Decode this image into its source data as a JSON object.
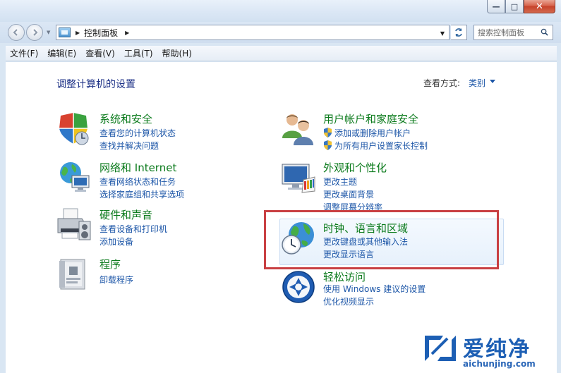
{
  "window": {
    "minimize_glyph": "—",
    "maximize_glyph": "□",
    "close_glyph": "✕"
  },
  "navigation": {
    "breadcrumb": "控制面板",
    "search_placeholder": "搜索控制面板"
  },
  "menu": {
    "items": [
      "文件(F)",
      "编辑(E)",
      "查看(V)",
      "工具(T)",
      "帮助(H)"
    ]
  },
  "main": {
    "title": "调整计算机的设置",
    "view_by_label": "查看方式:",
    "view_by_value": "类别"
  },
  "categories": {
    "system": {
      "title": "系统和安全",
      "links": [
        "查看您的计算机状态",
        "查找并解决问题"
      ]
    },
    "network": {
      "title": "网络和 Internet",
      "links": [
        "查看网络状态和任务",
        "选择家庭组和共享选项"
      ]
    },
    "hardware": {
      "title": "硬件和声音",
      "links": [
        "查看设备和打印机",
        "添加设备"
      ]
    },
    "programs": {
      "title": "程序",
      "links": [
        "卸载程序"
      ]
    },
    "user_accounts": {
      "title": "用户帐户和家庭安全",
      "links": [
        "添加或删除用户帐户",
        "为所有用户设置家长控制"
      ]
    },
    "appearance": {
      "title": "外观和个性化",
      "links": [
        "更改主题",
        "更改桌面背景",
        "调整屏幕分辨率"
      ]
    },
    "clock": {
      "title": "时钟、语言和区域",
      "links": [
        "更改键盘或其他输入法",
        "更改显示语言"
      ]
    },
    "ease": {
      "title": "轻松访问",
      "links": [
        "使用 Windows 建议的设置",
        "优化视频显示"
      ]
    }
  },
  "watermark": {
    "brand": "爱纯净",
    "url": "aichunjing.com"
  },
  "colors": {
    "category_title": "#0c7b1d",
    "link": "#1e57a8",
    "page_title": "#1e3287",
    "highlight_border": "#c94043"
  }
}
